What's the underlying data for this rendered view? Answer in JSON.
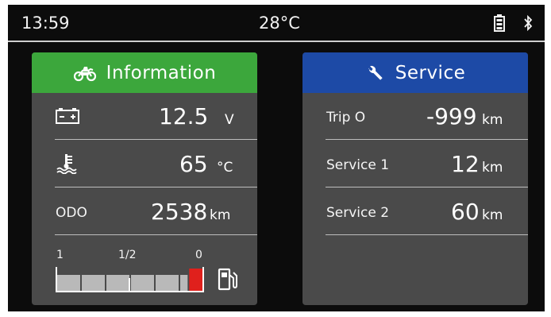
{
  "status": {
    "time": "13:59",
    "temperature": "28°C",
    "icons": [
      "battery-icon",
      "bluetooth-icon"
    ]
  },
  "information": {
    "title": "Information",
    "header_icon": "motorcycle-icon",
    "header_color": "#3ca73c",
    "rows": [
      {
        "icon": "battery-icon",
        "value": "12.5",
        "unit": "V"
      },
      {
        "icon": "coolant-temperature-icon",
        "value": "65",
        "unit": "°C"
      },
      {
        "label": "ODO",
        "value": "2538",
        "unit": "km"
      }
    ],
    "fuel": {
      "labels": [
        "1",
        "1/2",
        "0"
      ],
      "level": 0.1,
      "icon": "fuel-pump-icon",
      "low_color": "#e0201c"
    }
  },
  "service": {
    "title": "Service",
    "header_icon": "wrench-icon",
    "header_color": "#1d4aa6",
    "rows": [
      {
        "label": "Trip O",
        "value": "-999",
        "unit": "km"
      },
      {
        "label": "Service 1",
        "value": "12",
        "unit": "km"
      },
      {
        "label": "Service 2",
        "value": "60",
        "unit": "km"
      }
    ]
  }
}
